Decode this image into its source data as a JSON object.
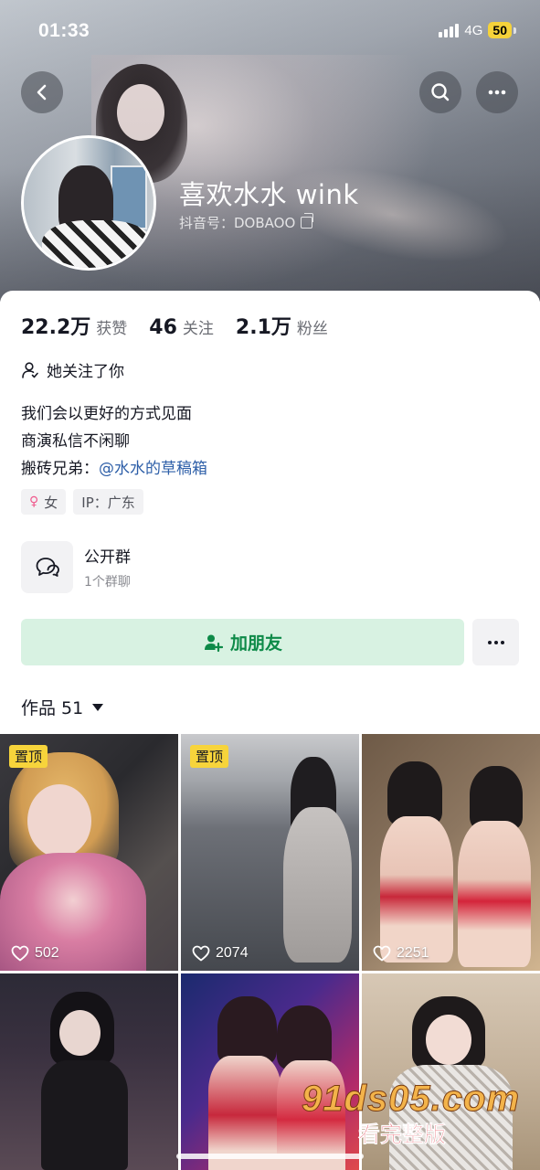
{
  "status_bar": {
    "time": "01:33",
    "network": "4G",
    "battery": "50"
  },
  "profile": {
    "name": "喜欢水水 wink",
    "douyin_id": "抖音号：DOBAOO"
  },
  "stats": [
    {
      "value": "22.2万",
      "label": "获赞"
    },
    {
      "value": "46",
      "label": "关注"
    },
    {
      "value": "2.1万",
      "label": "粉丝"
    }
  ],
  "follows_you": "她关注了你",
  "bio": {
    "line1": "我们会以更好的方式见面",
    "line2": "商演私信不闲聊",
    "line3_prefix": "搬砖兄弟：",
    "line3_mention": "@水水的草稿箱"
  },
  "tags": {
    "gender": "女",
    "ip": "IP：广东"
  },
  "group": {
    "title": "公开群",
    "subtitle": "1个群聊"
  },
  "actions": {
    "add_friend": "加朋友"
  },
  "works_tab": {
    "label": "作品 51"
  },
  "videos": [
    {
      "pinned": "置顶",
      "likes": "502"
    },
    {
      "pinned": "置顶",
      "likes": "2074"
    },
    {
      "likes": "2251"
    },
    {},
    {},
    {}
  ],
  "watermark": {
    "top": "91ds05.com",
    "bottom": "看完整版"
  },
  "colors": {
    "accent_green": "#0d8a48",
    "add_friend_bg": "#d8f2e2",
    "pin_badge": "#f7d43b",
    "mention": "#2e5fa8"
  }
}
